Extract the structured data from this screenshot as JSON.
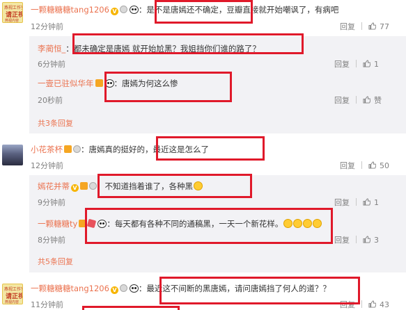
{
  "comments": [
    {
      "author": "一颗糖糖糖tang1206",
      "colon": "：",
      "text": "是不是唐嫣还不确定，豆瓣直接就开始嘲讽了，有病吧",
      "time": "12分钟前",
      "reply_label": "回复",
      "likes": "77",
      "avatar_lines": [
        "燕视工作室",
        "请正视",
        "燕视内容"
      ]
    },
    {
      "author": "小花茶杯",
      "colon": "：",
      "text": "唐嫣真的挺好的，最近这是怎么了",
      "time": "12分钟前",
      "reply_label": "回复",
      "likes": "50"
    },
    {
      "author": "一颗糖糖糖tang1206",
      "colon": "：",
      "text": "最近这不间断的黑唐嫣，请问唐嫣挡了何人的道？？",
      "time": "11分钟前",
      "reply_label": "回复",
      "likes": "43",
      "avatar_lines": [
        "燕视工作室",
        "请正视",
        "燕视内容"
      ]
    }
  ],
  "replies_group1": [
    {
      "author": "李蔺恒_",
      "colon": "：",
      "text": "都未确定是唐嫣   就开始尬黑？我姐挡你们谁的路了？",
      "time": "6分钟前",
      "reply_label": "回复",
      "likes": "1"
    },
    {
      "author": "一壹已驻似华年",
      "colon": "：",
      "text": "唐嫣为何这么惨",
      "time": "20秒前",
      "reply_label": "回复",
      "likes": "赞"
    }
  ],
  "more_group1": "共3条回复",
  "replies_group2": [
    {
      "author": "嫣花并蒂",
      "colon": "：",
      "text": "不知道挡着谁了，各种黑",
      "time": "9分钟前",
      "reply_label": "回复",
      "likes": "1"
    },
    {
      "author": "一颗糖糖ty",
      "colon": "：",
      "text": "每天都有各种不同的通稿黑，一天一个新花样。",
      "time": "8分钟前",
      "reply_label": "回复",
      "likes": "3"
    }
  ],
  "more_group2": "共5条回复",
  "colors": {
    "name": "#eb7350",
    "highlight": "#e0192a",
    "reply_bg": "#f2f2f5"
  }
}
